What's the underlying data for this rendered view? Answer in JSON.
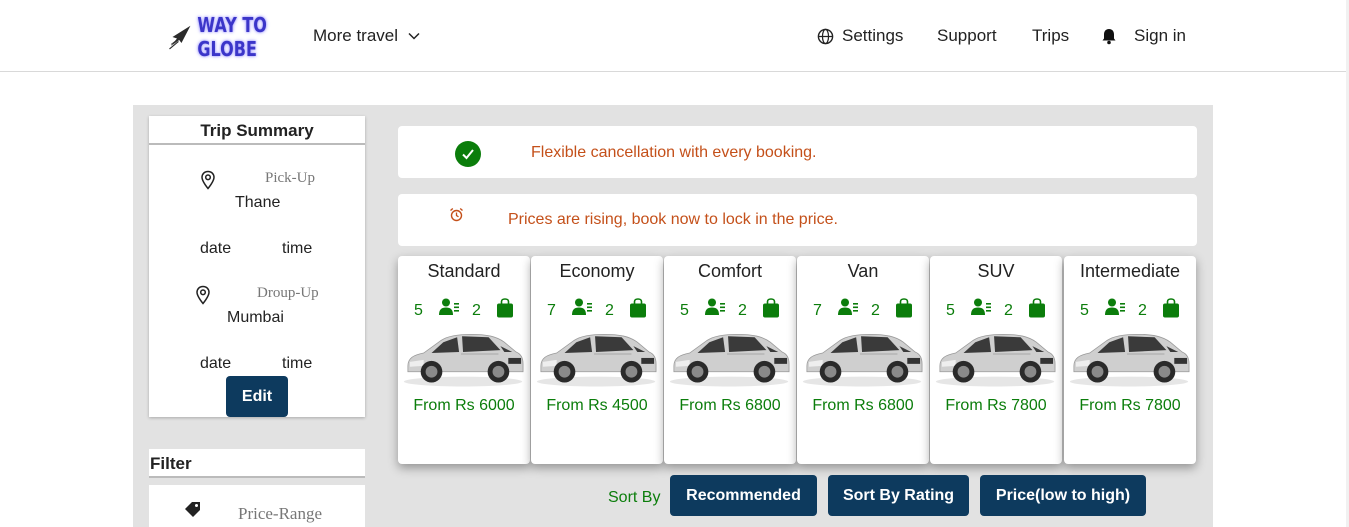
{
  "nav": {
    "logo_text": "WAY TO GLOBE",
    "more_travel": "More travel",
    "settings": "Settings",
    "support": "Support",
    "trips": "Trips",
    "sign_in": "Sign in"
  },
  "summary": {
    "title": "Trip Summary",
    "pickup_label": "Pick-Up",
    "pickup_value": "Thane",
    "pickup_date": "date",
    "pickup_time": "time",
    "dropoff_label": "Droup-Up",
    "dropoff_value": "Mumbai",
    "dropoff_date": "date",
    "dropoff_time": "time",
    "edit": "Edit"
  },
  "filter": {
    "title": "Filter",
    "price_range": "Price-Range"
  },
  "notices": {
    "cancellation": "Flexible cancellation with every booking.",
    "prices": "Prices are rising, book now to lock in the price."
  },
  "cars": [
    {
      "name": "Standard",
      "seats": "5",
      "bags": "2",
      "price": "From Rs 6000"
    },
    {
      "name": "Economy",
      "seats": "7",
      "bags": "2",
      "price": "From Rs 4500"
    },
    {
      "name": "Comfort",
      "seats": "5",
      "bags": "2",
      "price": "From Rs 6800"
    },
    {
      "name": "Van",
      "seats": "7",
      "bags": "2",
      "price": "From Rs 6800"
    },
    {
      "name": "SUV",
      "seats": "5",
      "bags": "2",
      "price": "From Rs 7800"
    },
    {
      "name": "Intermediate",
      "seats": "5",
      "bags": "2",
      "price": "From Rs 7800"
    }
  ],
  "sort": {
    "label": "Sort By",
    "recommended": "Recommended",
    "rating": "Sort By Rating",
    "price": "Price(low to high)"
  },
  "colors": {
    "primary_button": "#0d3a5e",
    "green": "#0b7d0b",
    "notice_text": "#c4501a",
    "panel_bg": "#e2e2e2"
  },
  "icons": [
    "plane-logo-icon",
    "chevron-down-icon",
    "globe-icon",
    "bell-icon",
    "location-pin-icon",
    "tag-icon",
    "check-circle-icon",
    "alarm-clock-icon",
    "person-icon",
    "luggage-icon"
  ]
}
